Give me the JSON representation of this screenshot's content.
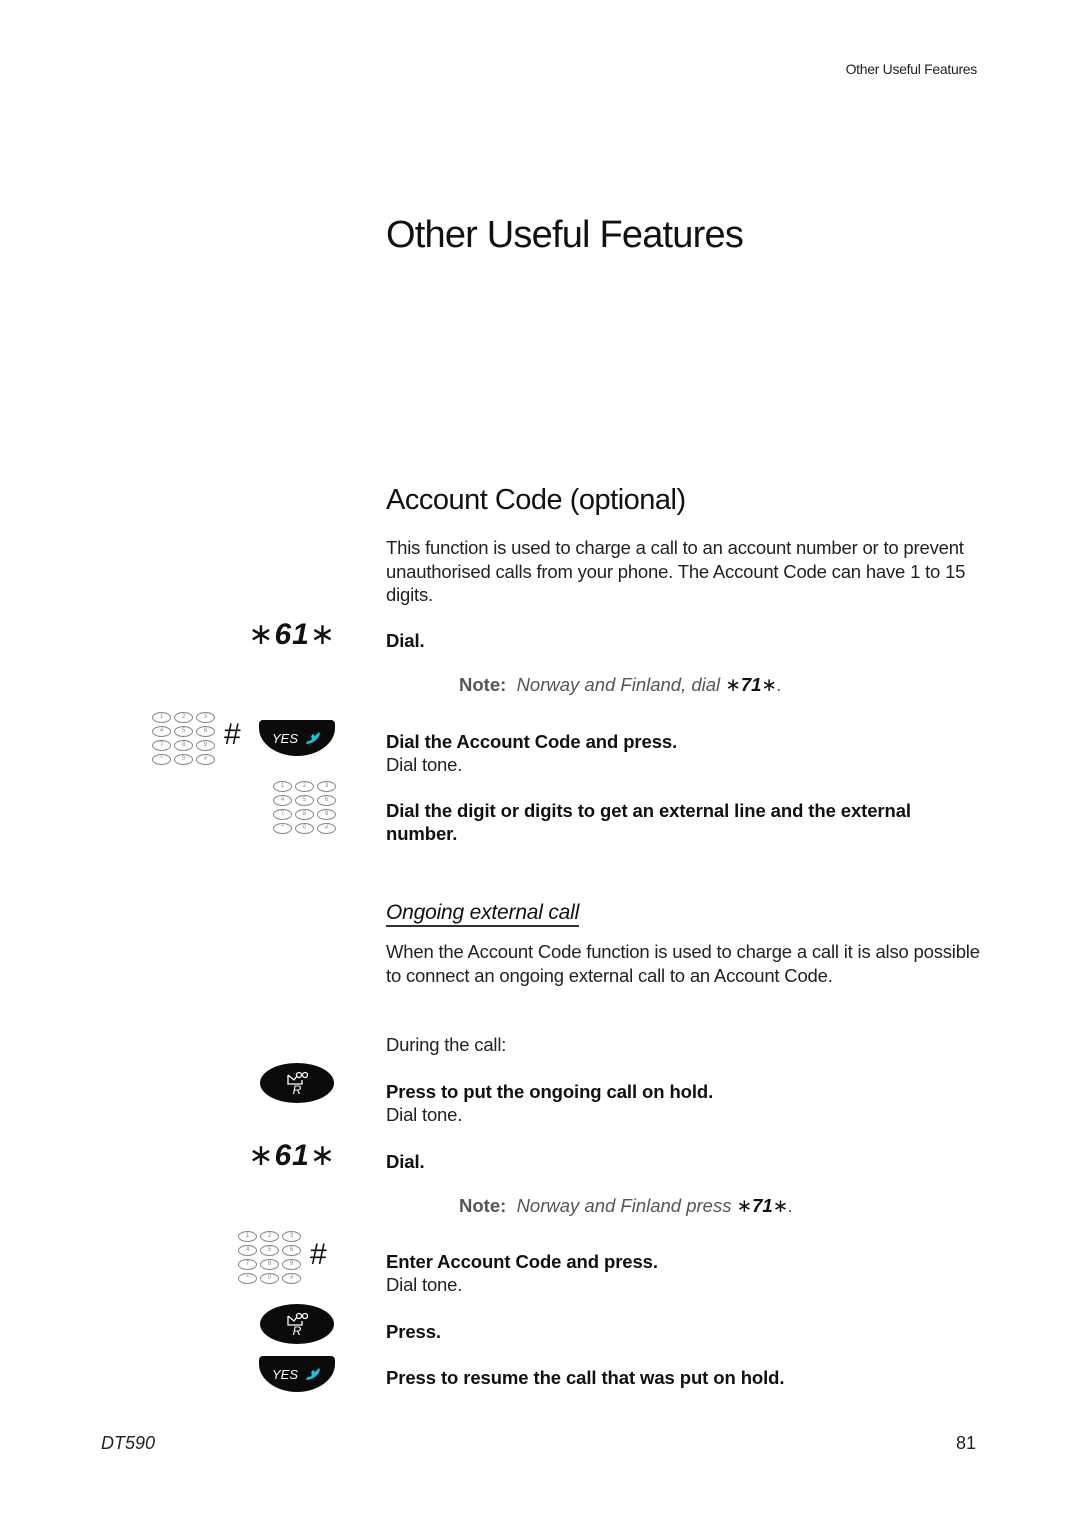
{
  "header": {
    "running_head": "Other Useful Features"
  },
  "chapter_title": "Other Useful Features",
  "section": {
    "title": "Account Code (optional)",
    "intro": "This function is used to charge a call to an account number or to prevent unauthorised calls from your phone. The Account Code can have 1 to 15 digits."
  },
  "steps_part1": {
    "code1": {
      "star": "∗",
      "digits": "61",
      "icon": "asterisk-code"
    },
    "dial": "Dial.",
    "note1": {
      "label": "Note:",
      "text": "Norway and Finland, dial",
      "code_digits": "71",
      "star": "∗",
      "end": "."
    },
    "dial_account_code": "Dial the Account Code and press.",
    "dial_tone_1": "Dial tone.",
    "dial_digits": "Dial the digit or digits to get an external line and the external number."
  },
  "subsection": {
    "title": "Ongoing external call",
    "intro": "When the Account Code function is used to charge a call it is also possible to connect an ongoing external call to an Account Code.",
    "during": "During the call:",
    "press_hold": "Press to put the ongoing call on hold.",
    "dial_tone_2": "Dial tone.",
    "code2": {
      "star": "∗",
      "digits": "61"
    },
    "dial2": "Dial.",
    "note2": {
      "label": "Note:",
      "text": "Norway and Finland press",
      "code_digits": "71",
      "star": "∗",
      "end": "."
    },
    "enter_code": "Enter Account Code and press.",
    "dial_tone_3": "Dial tone.",
    "press": "Press.",
    "resume": "Press to resume the call that was put on hold."
  },
  "icons": {
    "hash": "#",
    "yes_label": "YES",
    "r_label": "R",
    "keypad_keys": [
      "1",
      "2",
      "3",
      "4",
      "5",
      "6",
      "7",
      "8",
      "9",
      "*",
      "0",
      "#"
    ]
  },
  "footer": {
    "model": "DT590",
    "page_number": "81"
  },
  "colors": {
    "phone_icon": "#19c3d6",
    "button_black": "#0b0b0b",
    "note_gray": "#555555"
  }
}
